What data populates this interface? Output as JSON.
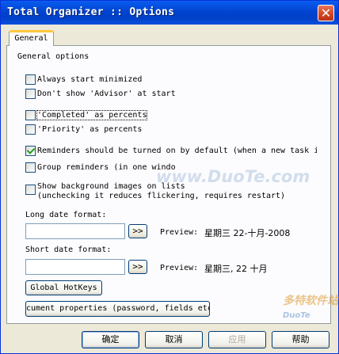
{
  "window": {
    "title": "Total Organizer :: Options",
    "close_glyph": "✕"
  },
  "tabs": [
    {
      "label": "General"
    }
  ],
  "general": {
    "group_label": "General options",
    "options": [
      {
        "label": "Always start minimized",
        "checked": false
      },
      {
        "label": "Don't show 'Advisor' at start",
        "checked": false
      },
      {
        "label": "'Completed' as percents",
        "checked": false
      },
      {
        "label": "'Priority' as percents",
        "checked": false
      },
      {
        "label": "Reminders should be turned on by default (when a new task i",
        "checked": true
      },
      {
        "label": "Group reminders (in one windo",
        "checked": false
      },
      {
        "label": "Show background images on lists",
        "label2": "(unchecking it reduces flickering, requires restart)",
        "checked": false
      }
    ],
    "long_date": {
      "label": "Long date format:",
      "value": "",
      "button": ">>",
      "preview_label": "Preview:",
      "preview_value": "星期三 22-十月-2008"
    },
    "short_date": {
      "label": "Short date format:",
      "value": "",
      "button": ">>",
      "preview_label": "Preview:",
      "preview_value": "星期三, 22 十月"
    },
    "hotkeys_button": "Global HotKeys",
    "doc_props_button": "cument properties (password, fields etc"
  },
  "footer": {
    "ok": "确定",
    "cancel": "取消",
    "apply": "应用",
    "help": "帮助"
  },
  "watermarks": {
    "center": "www.DuoTe.com",
    "corner_cn": "多特软件站",
    "corner_en": "DuoTe"
  }
}
